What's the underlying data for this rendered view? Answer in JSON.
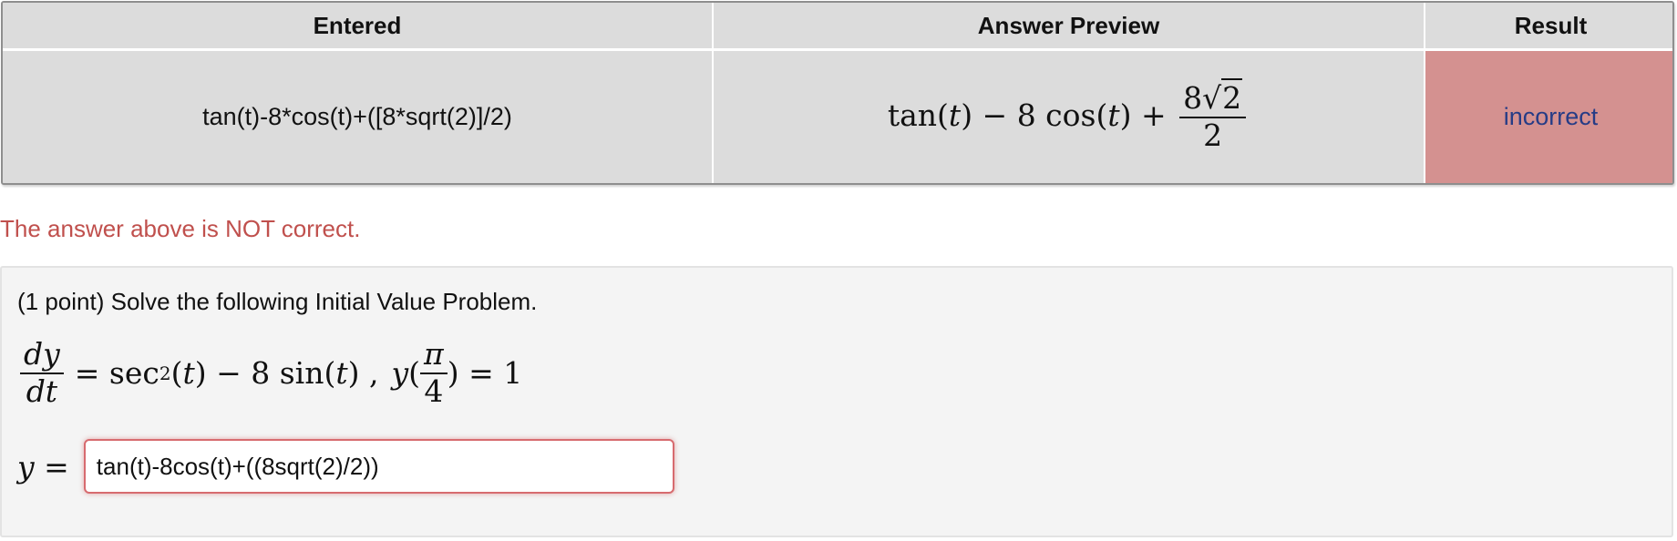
{
  "results_table": {
    "headers": {
      "entered": "Entered",
      "preview": "Answer Preview",
      "result": "Result"
    },
    "row": {
      "entered": "tan(t)-8*cos(t)+([8*sqrt(2)]/2)",
      "preview": {
        "lead": "tan(",
        "var": "t",
        "mid": ") − 8 cos(",
        "tail": ") +",
        "frac_coef": "8",
        "frac_radicand": "2",
        "frac_den": "2"
      },
      "result": "incorrect"
    }
  },
  "status_message": "The answer above is NOT correct.",
  "problem": {
    "prompt": "(1 point) Solve the following Initial Value Problem.",
    "equation": {
      "dy": "dy",
      "dt": "dt",
      "rhs_a": "= sec",
      "power": "2",
      "rhs_b": "(",
      "var": "t",
      "rhs_c": ") − 8 sin(",
      "rhs_d": ") ,",
      "cond_fn": "y",
      "cond_open": "(",
      "pi": "π",
      "four": "4",
      "cond_close": ") = 1"
    },
    "answer_label": "y =",
    "answer_value": "tan(t)-8cos(t)+((8sqrt(2)/2))"
  },
  "colors": {
    "incorrect_bg": "#d49190",
    "incorrect_text": "#263c86",
    "warning_text": "#c0504d",
    "input_border": "#d76b6f"
  }
}
